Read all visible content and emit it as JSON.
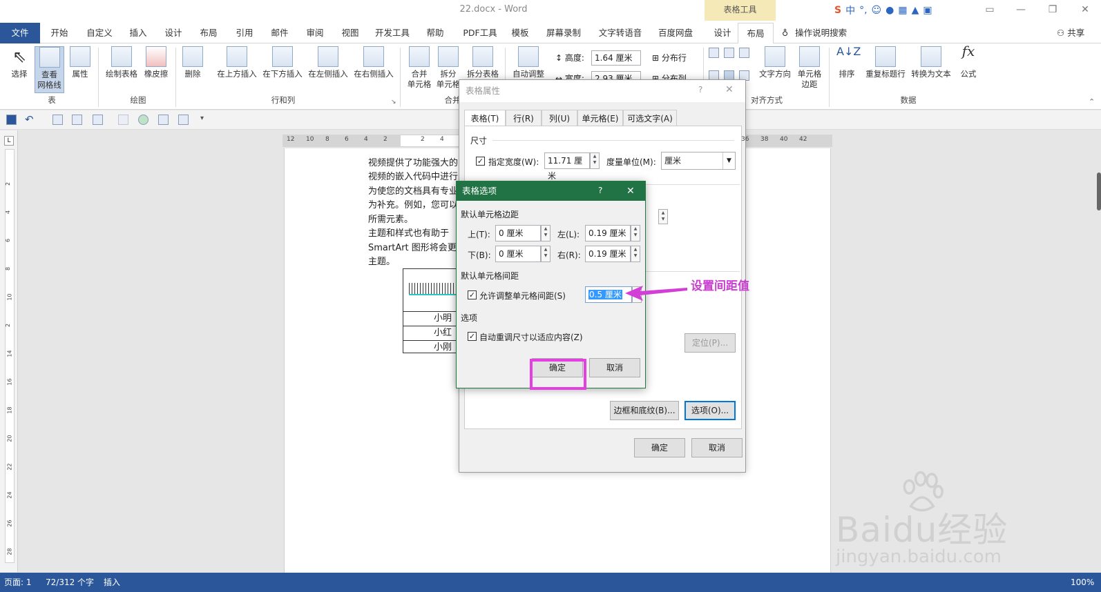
{
  "window": {
    "title": "22.docx - Word",
    "context_tab_group": "表格工具"
  },
  "menubar": {
    "tabs": [
      "文件",
      "开始",
      "自定义",
      "插入",
      "设计",
      "布局",
      "引用",
      "邮件",
      "审阅",
      "视图",
      "开发工具",
      "帮助",
      "PDF工具",
      "模板",
      "屏幕录制",
      "文字转语音",
      "百度网盘",
      "设计",
      "布局"
    ],
    "tell_me": "操作说明搜索",
    "share": "共享"
  },
  "ribbon": {
    "buttons": {
      "select": "选择",
      "view_gridlines": "查看\n网格线",
      "properties": "属性",
      "draw_table": "绘制表格",
      "eraser": "橡皮擦",
      "delete": "删除",
      "insert_above": "在上方插入",
      "insert_below": "在下方插入",
      "insert_left": "在左侧插入",
      "insert_right": "在右侧插入",
      "merge_cells": "合并\n单元格",
      "split_cells": "拆分\n单元格",
      "split_table": "拆分表格",
      "autofit": "自动调整",
      "height_label": "高度:",
      "height_value": "1.64 厘米",
      "width_label": "宽度:",
      "width_value": "2.93 厘米",
      "distribute_rows": "分布行",
      "distribute_cols": "分布列",
      "text_direction": "文字方向",
      "cell_margins": "单元格\n边距",
      "sort": "排序",
      "repeat_header": "重复标题行",
      "convert_text": "转换为文本",
      "formula": "公式"
    },
    "groups": {
      "table": "表",
      "draw": "绘图",
      "rows_cols": "行和列",
      "merge": "合并",
      "align": "对齐方式",
      "data": "数据"
    }
  },
  "ruler": {
    "h_ticks": [
      "12",
      "10",
      "8",
      "6",
      "4",
      "2",
      "2",
      "4",
      "36",
      "38",
      "40",
      "42"
    ],
    "v_ticks": [
      "2",
      "4",
      "6",
      "8",
      "10",
      "2",
      "14",
      "16",
      "18",
      "20",
      "22",
      "24",
      "26",
      "28"
    ]
  },
  "document": {
    "paragraphs": [
      "视频提供了功能强大的",
      "视频的嵌入代码中进行",
      "为使您的文档具有专业",
      "为补充。例如，您可以",
      "所需元素。",
      "主题和样式也有助于",
      "SmartArt 图形将会更",
      "主题。"
    ],
    "table_rows": [
      "小明",
      "小红",
      "小刚"
    ]
  },
  "table_properties": {
    "title": "表格属性",
    "help": "?",
    "close": "✕",
    "tabs": [
      "表格(T)",
      "行(R)",
      "列(U)",
      "单元格(E)",
      "可选文字(A)"
    ],
    "size_section": "尺寸",
    "preferred_width_label": "指定宽度(W):",
    "preferred_width_value": "11.71 厘米",
    "measure_label": "度量单位(M):",
    "measure_value": "厘米",
    "positioning_button": "定位(P)...",
    "borders_button": "边框和底纹(B)...",
    "options_button": "选项(O)...",
    "ok": "确定",
    "cancel": "取消"
  },
  "table_options": {
    "title": "表格选项",
    "help": "?",
    "close": "✕",
    "margins_section": "默认单元格边距",
    "top_label": "上(T):",
    "top_value": "0 厘米",
    "left_label": "左(L):",
    "left_value": "0.19 厘米",
    "bottom_label": "下(B):",
    "bottom_value": "0 厘米",
    "right_label": "右(R):",
    "right_value": "0.19 厘米",
    "spacing_section": "默认单元格间距",
    "allow_spacing_label": "允许调整单元格间距(S)",
    "allow_spacing_checked": true,
    "spacing_value": "0.5 厘米",
    "options_section": "选项",
    "autoresize_label": "自动重调尺寸以适应内容(Z)",
    "autoresize_checked": true,
    "ok": "确定",
    "cancel": "取消"
  },
  "annotation": {
    "text": "设置间距值",
    "color": "#c93fd0",
    "highlight_color": "#e43fe0"
  },
  "statusbar": {
    "page": "页面: 1",
    "words": "72/312 个字",
    "mode": "插入",
    "zoom": "100%"
  },
  "watermark": {
    "brand": "Baidu经验",
    "url": "jingyan.baidu.com"
  },
  "colors": {
    "word_blue": "#2b579a",
    "dialog_green": "#217346"
  }
}
